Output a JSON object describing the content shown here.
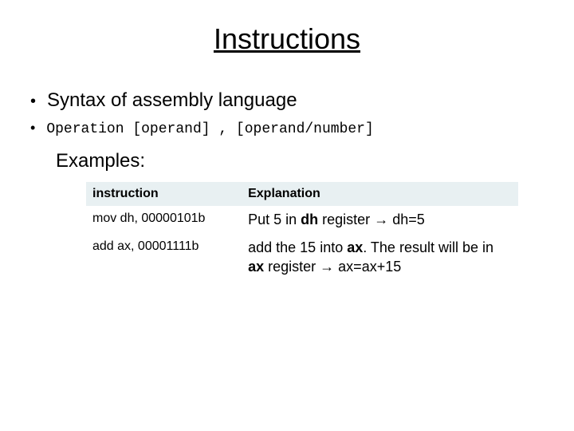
{
  "title": "Instructions",
  "bullet1": "Syntax of assembly language",
  "bullet2": "Operation [operand] , [operand/number]",
  "examples_label": "Examples:",
  "table": {
    "headers": {
      "instruction": "instruction",
      "explanation": "Explanation"
    },
    "rows": [
      {
        "instruction": "mov dh, 00000101b",
        "explanation": {
          "pre1": "Put 5 in ",
          "b1": "dh",
          "mid1": " register  ",
          "arrow": "→",
          "post1": "  dh=5"
        }
      },
      {
        "instruction": "add  ax, 00001111b",
        "explanation": {
          "pre1": "add the 15 into ",
          "b1": "ax",
          "mid1": ". The result will be in ",
          "b2": "ax",
          "mid2": " register ",
          "arrow": "→",
          "post1": " ax=ax+15"
        }
      }
    ]
  }
}
